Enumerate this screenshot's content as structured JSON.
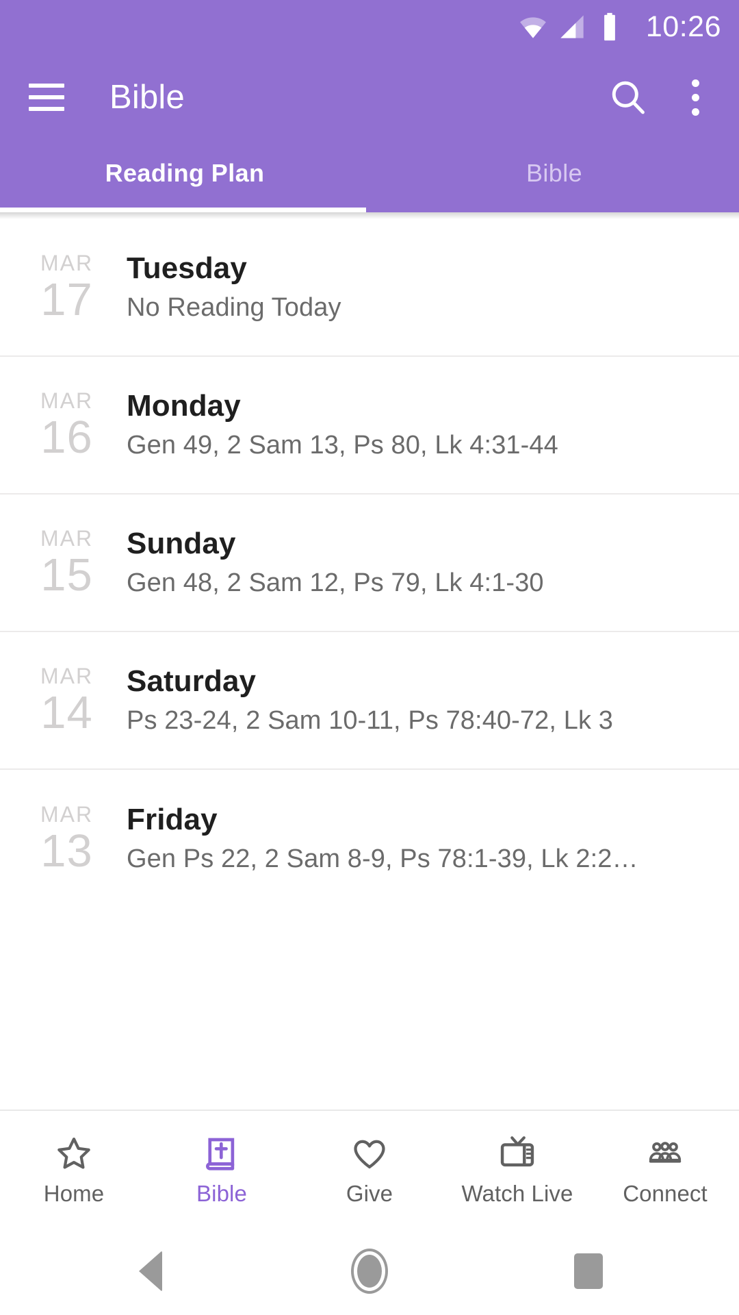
{
  "theme": {
    "primary": "#9170d1",
    "accent": "#8c63d6",
    "text_primary": "#1f1f1f",
    "text_secondary": "#6b6b6b",
    "date_gray": "#d2d0d0",
    "divider": "#eceaea"
  },
  "status_bar": {
    "time": "10:26",
    "wifi_icon": "wifi-icon",
    "signal_icon": "cell-signal-icon",
    "battery_icon": "battery-full-icon"
  },
  "app_bar": {
    "menu_icon": "hamburger-menu-icon",
    "title": "Bible",
    "search_icon": "search-icon",
    "overflow_icon": "overflow-menu-icon"
  },
  "tabs": {
    "active_index": 0,
    "items": [
      {
        "label": "Reading Plan",
        "active": true
      },
      {
        "label": "Bible",
        "active": false
      }
    ]
  },
  "reading_plan": {
    "rows": [
      {
        "month": "MAR",
        "day": "17",
        "title": "Tuesday",
        "readings": "No Reading Today"
      },
      {
        "month": "MAR",
        "day": "16",
        "title": "Monday",
        "readings": "Gen 49, 2 Sam 13, Ps 80, Lk 4:31-44"
      },
      {
        "month": "MAR",
        "day": "15",
        "title": "Sunday",
        "readings": "Gen 48, 2 Sam 12, Ps 79, Lk 4:1-30"
      },
      {
        "month": "MAR",
        "day": "14",
        "title": "Saturday",
        "readings": "Ps 23-24, 2 Sam 10-11, Ps 78:40-72, Lk 3"
      },
      {
        "month": "MAR",
        "day": "13",
        "title": "Friday",
        "readings": "Gen Ps 22, 2 Sam 8-9, Ps 78:1-39, Lk 2:2…"
      }
    ]
  },
  "bottom_nav": {
    "active_index": 1,
    "items": [
      {
        "label": "Home",
        "icon": "star-outline-icon",
        "active": false
      },
      {
        "label": "Bible",
        "icon": "bible-book-cross-icon",
        "active": true
      },
      {
        "label": "Give",
        "icon": "heart-outline-icon",
        "active": false
      },
      {
        "label": "Watch Live",
        "icon": "television-icon",
        "active": false
      },
      {
        "label": "Connect",
        "icon": "people-group-icon",
        "active": false
      }
    ]
  },
  "system_nav": {
    "back_icon": "back-triangle-icon",
    "home_icon": "home-circle-icon",
    "recents_icon": "recents-square-icon"
  }
}
